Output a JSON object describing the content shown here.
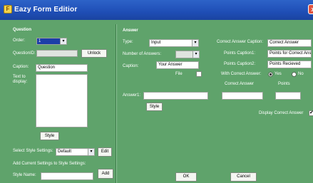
{
  "window": {
    "title": "Eazy Form Editior",
    "close_glyph": "x"
  },
  "question": {
    "section_title": "Question",
    "order_label": "Order:",
    "order_value": "1",
    "question_id_label": "QuestionID:",
    "question_id_value": "",
    "unlock_label": "Unlock",
    "caption_label": "Caption:",
    "caption_value": "Question",
    "text_label": "Text to display:",
    "style_button": "Style",
    "select_style_label": "Select Style Settings:",
    "style_select_value": "Default",
    "edit_button": "Edit",
    "add_settings_label": "Add Current Settings to Style Settings:",
    "style_name_label": "Style Name:",
    "style_name_value": "",
    "add_button": "Add"
  },
  "answer": {
    "section_title": "Answer",
    "type_label": "Type:",
    "type_value": "Input",
    "num_answers_label": "Number of Answers:",
    "num_answers_value": "",
    "caption_label": "Caption:",
    "caption_value": "Your Answer",
    "file_label": "File",
    "correct_caption_label": "Correct Answer Caption:",
    "correct_caption_value": "Correct Answer",
    "points_caption1_label": "Points Caption1:",
    "points_caption1_value": "Points for Correct Answ",
    "points_caption2_label": "Points Caption2:",
    "points_caption2_value": "Points Recieved",
    "with_correct_label": "With Correct Answer:",
    "yes_label": "Yes",
    "no_label": "No",
    "correct_answer_col": "Correct Answer",
    "points_col": "Points",
    "answer1_label": "Answer1:",
    "answer1_value": "",
    "correct1_value": "",
    "points1_value": "",
    "style_button": "Style",
    "display_correct_label": "Display Correct Answer",
    "ok_button": "OK",
    "cancel_button": "Cancel"
  },
  "colors": {
    "background": "#5fa36b",
    "titlebar": "#2d63c8"
  }
}
